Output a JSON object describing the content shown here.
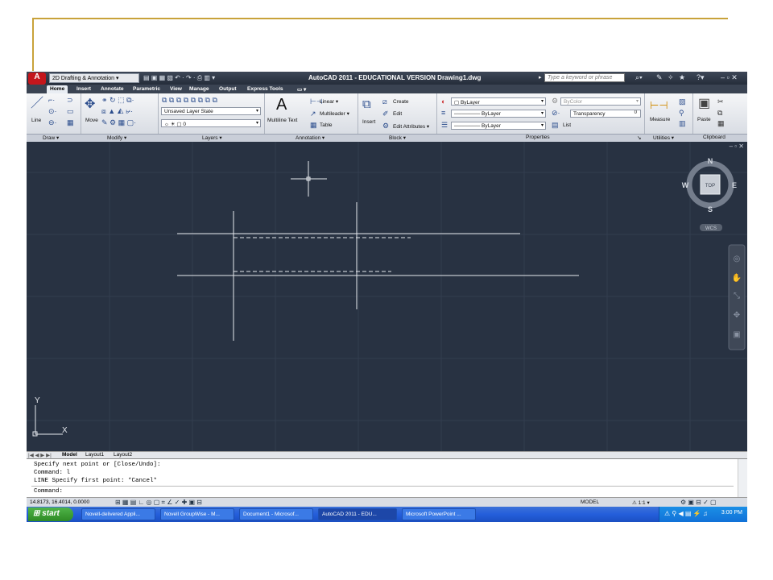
{
  "workspace": "2D Drafting & Annotation",
  "window_title": "AutoCAD 2011 - EDUCATIONAL VERSION    Drawing1.dwg",
  "search_placeholder": "Type a keyword or phrase",
  "tabs": [
    "Home",
    "Insert",
    "Annotate",
    "Parametric",
    "View",
    "Manage",
    "Output",
    "Express Tools"
  ],
  "ribbon": {
    "draw": {
      "title": "Draw",
      "line": "Line"
    },
    "modify": {
      "title": "Modify",
      "move": "Move"
    },
    "layers": {
      "title": "Layers",
      "layer_state": "Unsaved Layer State",
      "current_layer": "0"
    },
    "annotation": {
      "title": "Annotation",
      "mtext": "Multiline Text",
      "linear": "Linear",
      "multileader": "Multileader",
      "table": "Table"
    },
    "block": {
      "title": "Block",
      "insert": "Insert",
      "create": "Create",
      "edit": "Edit",
      "edit_attributes": "Edit Attributes"
    },
    "properties": {
      "title": "Properties",
      "color": "ByLayer",
      "linetype": "ByLayer",
      "lineweight": "ByLayer",
      "plotstyle": "ByColor",
      "transparency_label": "Transparency",
      "transparency_value": "0",
      "list": "List"
    },
    "utilities": {
      "title": "Utilities",
      "measure": "Measure"
    },
    "clipboard": {
      "title": "Clipboard",
      "paste": "Paste"
    }
  },
  "viewcube": {
    "north": "N",
    "south": "S",
    "east": "E",
    "west": "W",
    "face": "TOP",
    "wcs": "WCS"
  },
  "ucs": {
    "x": "X",
    "y": "Y"
  },
  "layout_tabs": [
    "Model",
    "Layout1",
    "Layout2"
  ],
  "command_history": [
    "Specify next point or [Close/Undo]:",
    "Command: l",
    "LINE Specify first point: *Cancel*"
  ],
  "command_prompt": "Command:",
  "coordinates": "14.8173, 16.4014, 0.0000",
  "status_model": "MODEL",
  "annotation_scale": "1:1",
  "taskbar": {
    "start": "start",
    "items": [
      "Novell-delivered Appli...",
      "Novell GroupWise - M...",
      "Document1 - Microsof...",
      "AutoCAD 2011 - EDU...",
      "Microsoft PowerPoint ..."
    ],
    "clock": "3:00 PM"
  }
}
